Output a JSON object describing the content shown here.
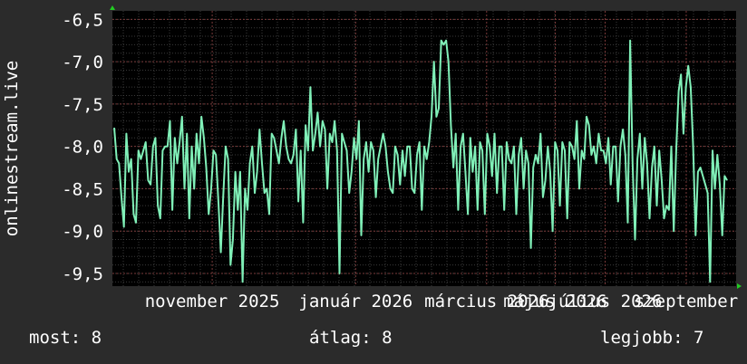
{
  "colors": {
    "background": "#2b2b2b",
    "plot_background": "#000000",
    "line": "#80f0b8",
    "grid_major": "#7a3a3a",
    "grid_minor": "#3a3a3a",
    "axis_arrow": "#22cc22"
  },
  "chart_data": {
    "type": "line",
    "title": "",
    "ylabel": "onlinestream.live",
    "xlabel": "",
    "ylim": [
      -9.65,
      -6.4
    ],
    "y_ticks": [
      "-6,5",
      "-7,0",
      "-7,5",
      "-8,0",
      "-8,5",
      "-9,0",
      "-9,5"
    ],
    "y_tick_values": [
      -6.5,
      -7.0,
      -7.5,
      -8.0,
      -8.5,
      -9.0,
      -9.5
    ],
    "x_ticks": [
      "november 2025",
      "január 2026",
      "március 2026",
      "május 2026",
      "július 2026",
      "szeptember"
    ],
    "x_tick_values": [
      0.16,
      0.39,
      0.6,
      0.71,
      0.79,
      0.92
    ],
    "grid": true,
    "series": [
      {
        "values": [
          -7.78,
          -8.15,
          -8.2,
          -8.6,
          -8.95,
          -7.85,
          -8.3,
          -8.15,
          -8.8,
          -8.9,
          -8.05,
          -8.15,
          -8.05,
          -7.95,
          -8.4,
          -8.45,
          -8.0,
          -7.9,
          -8.7,
          -8.85,
          -8.05,
          -8.0,
          -8.0,
          -7.7,
          -8.75,
          -7.9,
          -8.2,
          -7.95,
          -7.65,
          -8.5,
          -7.85,
          -8.85,
          -8.0,
          -8.5,
          -7.85,
          -8.2,
          -7.65,
          -7.9,
          -8.25,
          -8.8,
          -8.5,
          -8.05,
          -8.1,
          -8.65,
          -9.25,
          -8.6,
          -8.0,
          -8.15,
          -9.4,
          -9.1,
          -8.3,
          -8.75,
          -8.3,
          -9.6,
          -8.5,
          -8.75,
          -8.2,
          -8.0,
          -8.55,
          -8.3,
          -7.8,
          -8.2,
          -8.55,
          -8.5,
          -8.8,
          -7.85,
          -7.9,
          -8.05,
          -8.2,
          -7.9,
          -7.7,
          -8.0,
          -8.15,
          -8.2,
          -8.1,
          -7.8,
          -8.65,
          -8.05,
          -8.9,
          -7.75,
          -8.05,
          -7.3,
          -8.05,
          -7.85,
          -7.6,
          -8.0,
          -7.7,
          -7.8,
          -8.5,
          -7.85,
          -7.95,
          -7.7,
          -8.05,
          -9.5,
          -7.85,
          -7.95,
          -8.05,
          -8.55,
          -8.3,
          -7.9,
          -8.15,
          -7.7,
          -9.05,
          -8.15,
          -7.95,
          -8.3,
          -7.95,
          -8.05,
          -8.6,
          -8.15,
          -8.0,
          -7.85,
          -8.0,
          -8.3,
          -8.5,
          -8.55,
          -8.0,
          -8.1,
          -8.45,
          -8.05,
          -8.35,
          -8.0,
          -8.0,
          -8.5,
          -8.55,
          -8.1,
          -7.95,
          -8.75,
          -8.0,
          -8.15,
          -7.95,
          -7.65,
          -7.0,
          -7.65,
          -7.55,
          -6.75,
          -6.8,
          -6.75,
          -7.0,
          -7.75,
          -8.25,
          -7.85,
          -8.75,
          -8.0,
          -7.85,
          -8.3,
          -8.8,
          -7.9,
          -8.3,
          -8.0,
          -8.75,
          -7.95,
          -8.05,
          -8.8,
          -7.85,
          -8.0,
          -8.35,
          -7.85,
          -8.55,
          -8.0,
          -8.0,
          -8.75,
          -7.95,
          -8.15,
          -8.2,
          -8.0,
          -8.8,
          -8.1,
          -7.9,
          -8.5,
          -8.05,
          -8.2,
          -9.2,
          -8.25,
          -8.1,
          -8.2,
          -7.85,
          -8.6,
          -8.4,
          -8.0,
          -8.3,
          -9.0,
          -7.95,
          -8.05,
          -8.7,
          -7.95,
          -8.05,
          -8.85,
          -7.95,
          -8.0,
          -8.15,
          -7.7,
          -8.5,
          -8.05,
          -8.15,
          -7.65,
          -7.75,
          -8.1,
          -8.0,
          -8.2,
          -7.85,
          -8.05,
          -8.05,
          -8.2,
          -7.9,
          -8.45,
          -8.0,
          -8.0,
          -8.65,
          -8.0,
          -7.8,
          -8.1,
          -8.9,
          -6.75,
          -8.2,
          -9.1,
          -8.15,
          -7.85,
          -8.5,
          -7.9,
          -8.2,
          -8.85,
          -8.25,
          -8.0,
          -8.7,
          -8.05,
          -8.4,
          -8.85,
          -8.7,
          -8.75,
          -8.0,
          -9.0,
          -8.05,
          -7.35,
          -7.15,
          -7.85,
          -7.3,
          -7.05,
          -7.3,
          -8.0,
          -9.05,
          -8.3,
          -8.25,
          -8.35,
          -8.45,
          -8.55,
          -9.6,
          -8.05,
          -8.5,
          -8.1,
          -8.45,
          -9.05,
          -8.35,
          -8.4
        ]
      }
    ]
  },
  "stats": {
    "current": "most: 8",
    "average": "átlag: 8",
    "best": "legjobb: 7"
  }
}
